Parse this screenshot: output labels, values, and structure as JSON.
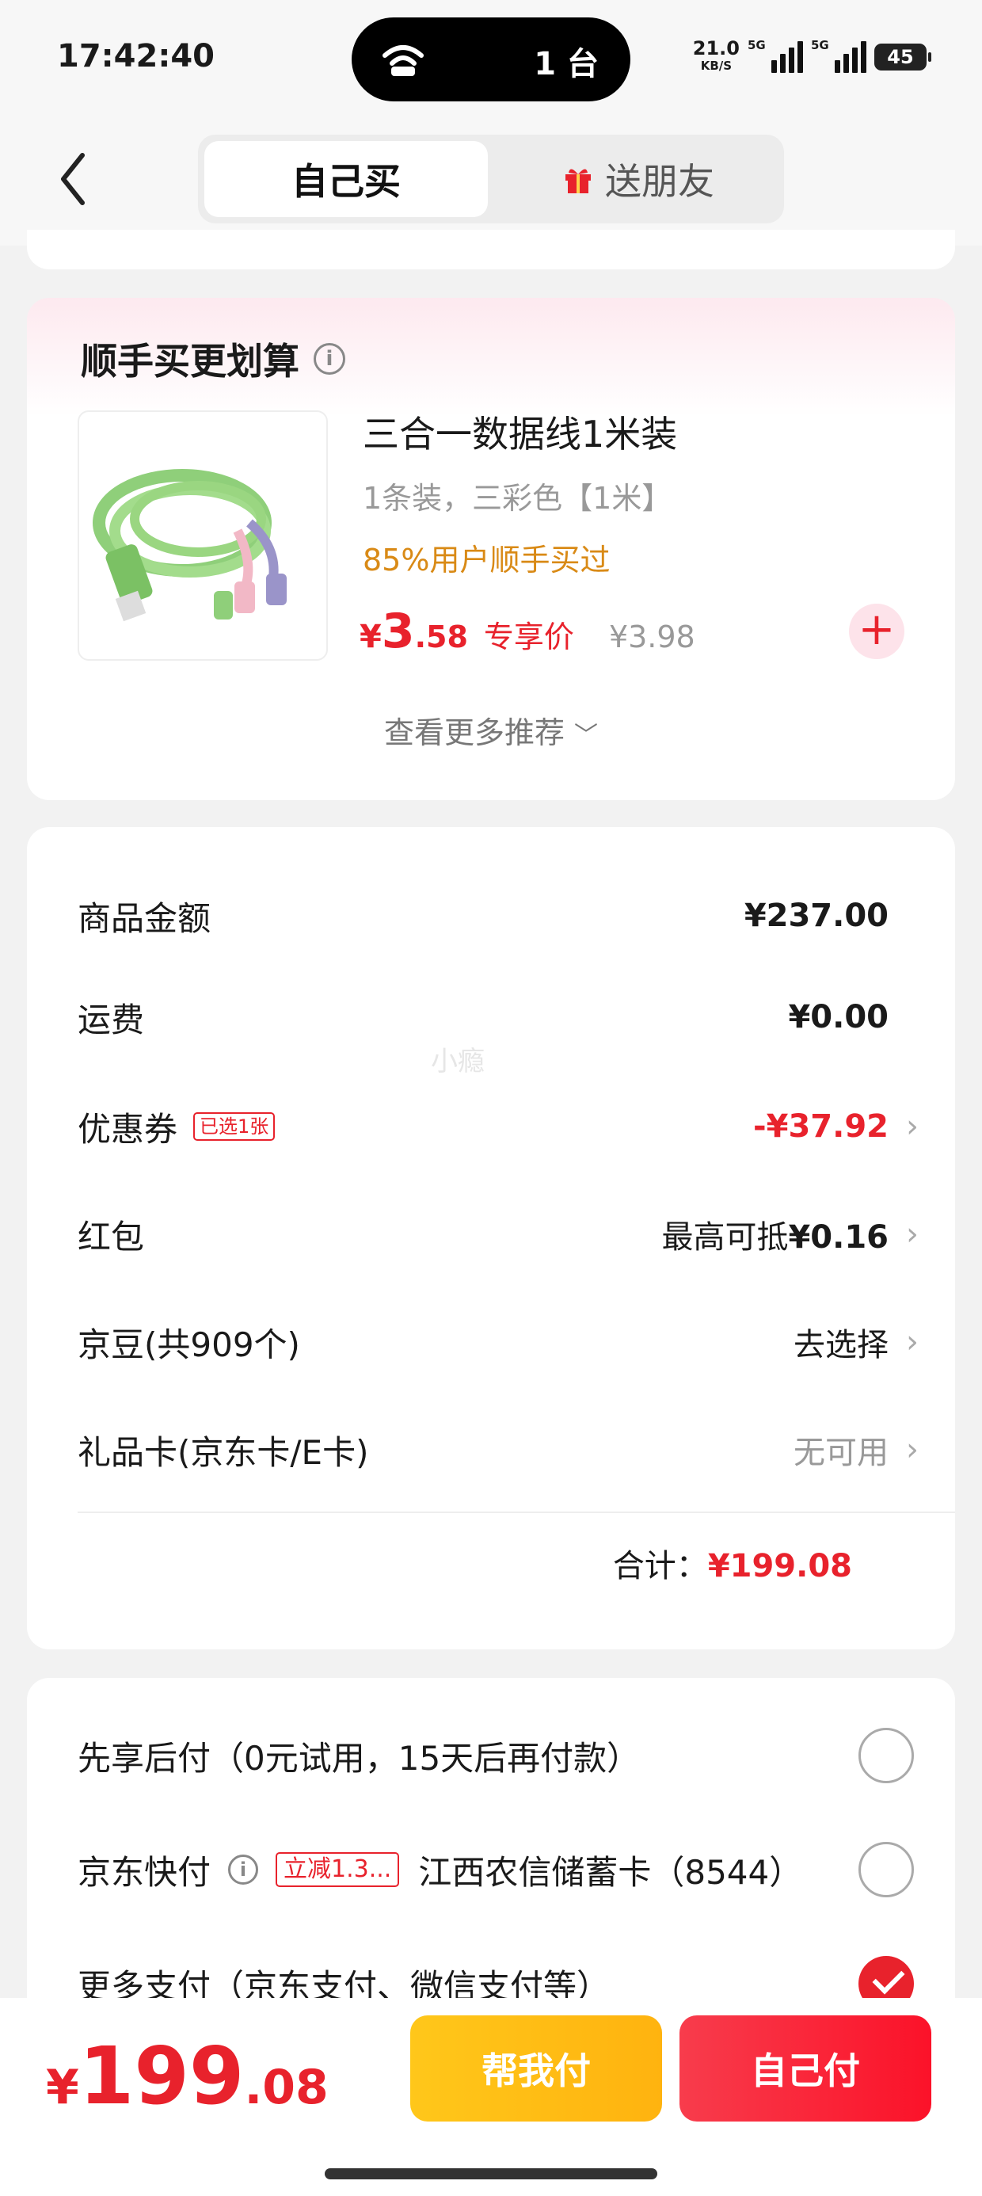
{
  "status_bar": {
    "time": "17:42:40",
    "island_count": "1 台",
    "net_speed": "21.0",
    "net_unit": "KB/S",
    "sim1_label": "5G",
    "sim2_label": "5G",
    "battery": "45"
  },
  "header": {
    "tab_self": "自己买",
    "tab_gift": "送朋友"
  },
  "recommend": {
    "title": "顺手买更划算",
    "product": {
      "name": "三合一数据线1米装",
      "spec": "1条装，三彩色【1米】",
      "social_proof": "85%用户顺手买过",
      "currency": "¥",
      "price_int": "3",
      "price_dec": ".58",
      "price_tag": "专享价",
      "original_price": "¥3.98"
    },
    "more_label": "查看更多推荐",
    "more_chevron": "﹀"
  },
  "summary": {
    "watermark": "小瘾",
    "rows": [
      {
        "label": "商品金额",
        "value": "¥237.00"
      },
      {
        "label": "运费",
        "value": "¥0.00"
      },
      {
        "label": "优惠券",
        "badge": "已选1张",
        "value": "-¥37.92"
      },
      {
        "label": "红包",
        "value_prefix": "最高可抵",
        "value": "¥0.16"
      },
      {
        "label": "京豆(共909个)",
        "value": "去选择"
      },
      {
        "label": "礼品卡(京东卡/E卡)",
        "value": "无可用"
      }
    ],
    "total_label": "合计：",
    "total_value": "¥199.08"
  },
  "payment": {
    "options": [
      {
        "label": "先享后付（0元试用，15天后再付款）",
        "selected": false
      },
      {
        "label": "京东快付",
        "promo": "立减1.3...",
        "detail": "江西农信储蓄卡（8544）",
        "selected": false
      },
      {
        "label": "更多支付（京东支付、微信支付等）",
        "selected": true
      }
    ]
  },
  "bottom_bar": {
    "currency": "¥",
    "total_int": "199",
    "total_dec": ".08",
    "help_pay_label": "帮我付",
    "self_pay_label": "自己付"
  },
  "colors": {
    "accent_red": "#e8222c",
    "help_yellow": "#ffb30f",
    "tag_orange": "#d98a16"
  }
}
